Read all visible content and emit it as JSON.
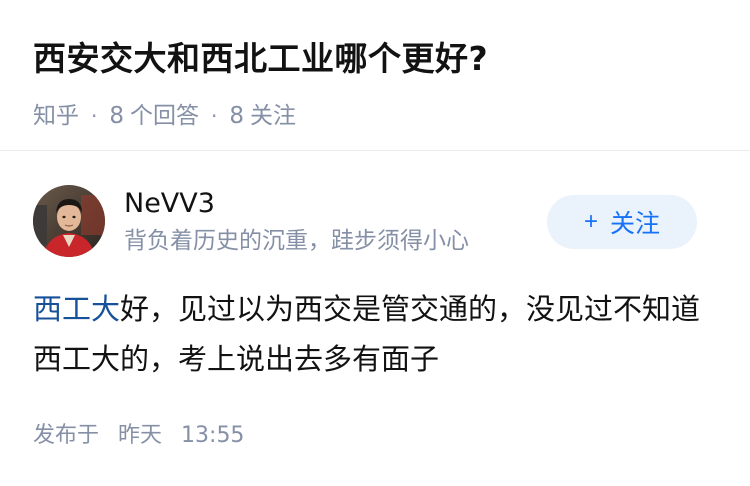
{
  "question": {
    "title": "西安交大和西北工业哪个更好?",
    "source": "知乎",
    "separator": "·",
    "answer_count": "8",
    "answer_label": "个回答",
    "follower_count": "8",
    "follower_label": "关注"
  },
  "author": {
    "name": "NeVV3",
    "bio": "背负着历史的沉重，跬步须得小心",
    "follow_plus": "+",
    "follow_label": "关注"
  },
  "answer": {
    "link_text": "西工大",
    "body": "好，见过以为西交是管交通的，没见过不知道西工大的，考上说出去多有面子"
  },
  "footer": {
    "publish_label": "发布于",
    "day": "昨天",
    "time": "13:55"
  },
  "colors": {
    "accent": "#1772f6",
    "link": "#175199",
    "meta": "#8590a6",
    "follow_bg": "#eaf2fb"
  },
  "icons": {
    "avatar": "avatar-photo"
  }
}
